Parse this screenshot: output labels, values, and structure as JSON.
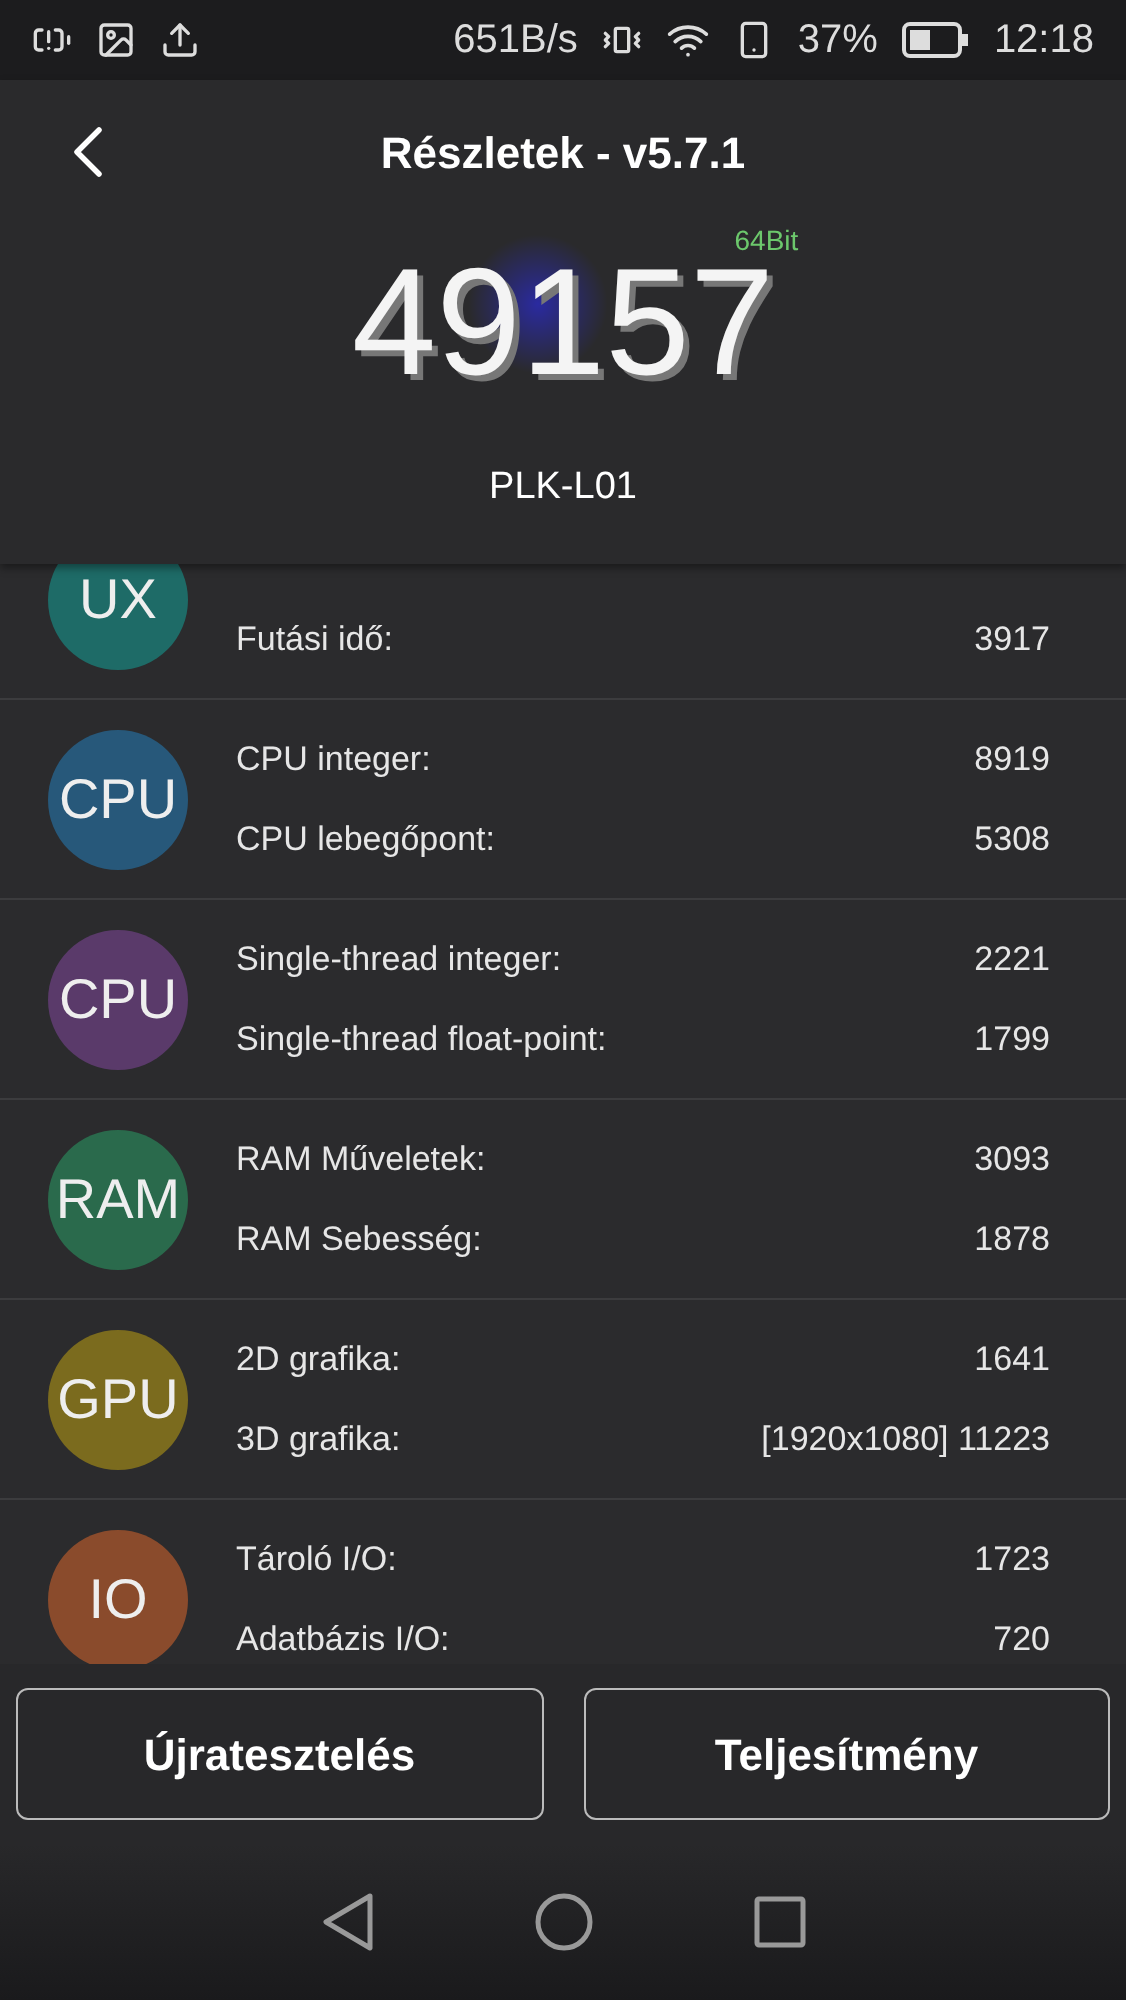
{
  "status_bar": {
    "net_speed": "651B/s",
    "battery": "37%",
    "time": "12:18"
  },
  "header": {
    "title": "Részletek - v5.7.1",
    "score": "49157",
    "badge": "64Bit",
    "device": "PLK-L01"
  },
  "groups": [
    {
      "icon_label": "UX",
      "color": "#1e6b67",
      "rows": [
        {
          "label": "Futási idő:",
          "value": "3917"
        }
      ]
    },
    {
      "icon_label": "CPU",
      "color": "#27587a",
      "rows": [
        {
          "label": "CPU integer:",
          "value": "8919"
        },
        {
          "label": "CPU lebegőpont:",
          "value": "5308"
        }
      ]
    },
    {
      "icon_label": "CPU",
      "color": "#5a3a6a",
      "rows": [
        {
          "label": "Single-thread integer:",
          "value": "2221"
        },
        {
          "label": "Single-thread float-point:",
          "value": "1799"
        }
      ]
    },
    {
      "icon_label": "RAM",
      "color": "#2a6a4c",
      "rows": [
        {
          "label": "RAM Műveletek:",
          "value": "3093"
        },
        {
          "label": "RAM Sebesség:",
          "value": "1878"
        }
      ]
    },
    {
      "icon_label": "GPU",
      "color": "#7b6b1e",
      "rows": [
        {
          "label": "2D grafika:",
          "value": "1641"
        },
        {
          "label": "3D grafika:",
          "value": "[1920x1080] 11223"
        }
      ]
    },
    {
      "icon_label": "IO",
      "color": "#8a4b2c",
      "rows": [
        {
          "label": "Tároló I/O:",
          "value": "1723"
        },
        {
          "label": "Adatbázis I/O:",
          "value": "720"
        }
      ]
    }
  ],
  "buttons": [
    "Újratesztelés",
    "Teljesítmény"
  ]
}
